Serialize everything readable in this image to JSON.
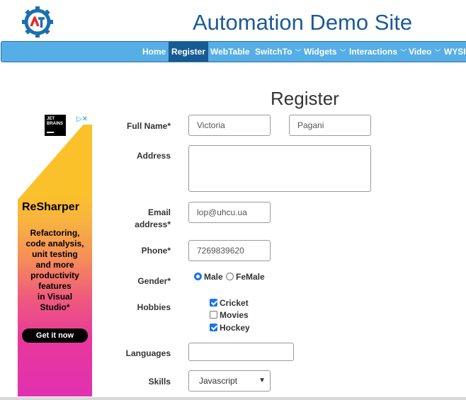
{
  "site": {
    "title": "Automation Demo Site",
    "logo_icon": "gear-logo-icon",
    "brand_colors": {
      "title": "#1c5b94",
      "nav": "#56aee6",
      "nav_active": "#165b93",
      "logo_blue": "#1a6fb0",
      "logo_red": "#e52a2a"
    }
  },
  "nav": {
    "home": "Home",
    "register": "Register",
    "webtable": "WebTable",
    "switchto": "SwitchTo",
    "widgets": "Widgets",
    "interactions": "Interactions",
    "video": "Video",
    "wysiwyg": "WYSI",
    "caret_icon": "chevron-down-icon"
  },
  "ad": {
    "brand": "JET BRAINS",
    "product": "ReSharper",
    "text_lines": [
      "Refactoring,",
      "code analysis,",
      "unit testing",
      "and more",
      "productivity",
      "features",
      "in Visual",
      "Studio*"
    ],
    "cta": "Get it now",
    "icons": "▷✕"
  },
  "form": {
    "heading": "Register",
    "full_name_label": "Full Name*",
    "first_name": "Victoria",
    "last_name": "Pagani",
    "address_label": "Address",
    "address_value": "",
    "email_label_1": "Email",
    "email_label_2": "address*",
    "email_value": "lop@uhcu.ua",
    "phone_label": "Phone*",
    "phone_value": "7269839620",
    "gender_label": "Gender*",
    "gender_options": [
      "Male",
      "FeMale"
    ],
    "gender_selected": "Male",
    "hobbies_label": "Hobbies",
    "hobbies": [
      {
        "label": "Cricket",
        "checked": true
      },
      {
        "label": "Movies",
        "checked": false
      },
      {
        "label": "Hockey",
        "checked": true
      }
    ],
    "languages_label": "Languages",
    "languages_value": "",
    "skills_label": "Skills",
    "skills_value": "Javascript"
  }
}
